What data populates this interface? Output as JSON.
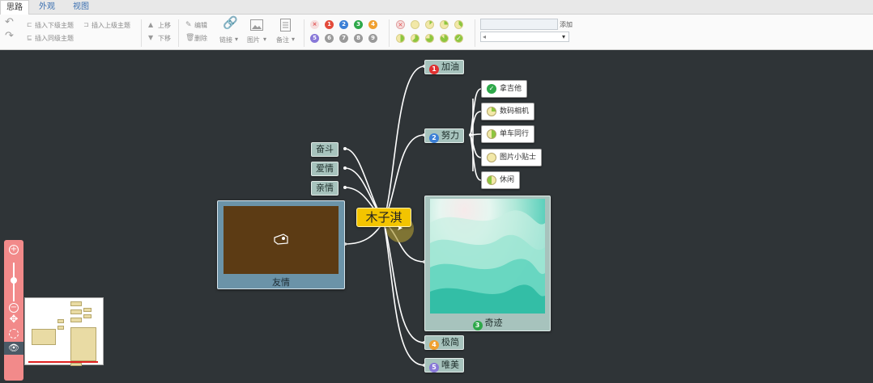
{
  "tabs": [
    {
      "label": "思路",
      "active": true
    },
    {
      "label": "外观",
      "active": false
    },
    {
      "label": "视图",
      "active": false
    }
  ],
  "toolbar": {
    "insert_child": "插入下级主题",
    "insert_parent": "插入上级主题",
    "insert_sibling": "插入同级主题",
    "move_up": "上移",
    "move_down": "下移",
    "edit": "编辑",
    "delete": "删除",
    "link": "链接",
    "image": "图片",
    "note": "备注",
    "priority_icons": [
      {
        "label": "×",
        "color": "#f0a0a0"
      },
      {
        "label": "1",
        "color": "#e34a3a"
      },
      {
        "label": "2",
        "color": "#3b7fd6"
      },
      {
        "label": "3",
        "color": "#2ea84a"
      },
      {
        "label": "4",
        "color": "#f0a030"
      },
      {
        "label": "5",
        "color": "#8878d8"
      },
      {
        "label": "6",
        "color": "#9a9a9a"
      },
      {
        "label": "7",
        "color": "#9a9a9a"
      },
      {
        "label": "8",
        "color": "#9a9a9a"
      },
      {
        "label": "9",
        "color": "#9a9a9a"
      }
    ],
    "progress_icons": [
      {
        "fraction": null
      },
      {
        "fraction": 0
      },
      {
        "fraction": 0.125
      },
      {
        "fraction": 0.25
      },
      {
        "fraction": 0.375
      },
      {
        "fraction": 0.5
      },
      {
        "fraction": 0.625
      },
      {
        "fraction": 0.75
      },
      {
        "fraction": 0.875
      },
      {
        "fraction": 1
      }
    ],
    "select_right": "添加",
    "select_left": "◂"
  },
  "mindmap": {
    "root": "木子淇",
    "branches": {
      "jiayou": {
        "label": "加油",
        "priority": "1",
        "priority_color": "#e03030"
      },
      "nuli": {
        "label": "努力",
        "priority": "2",
        "priority_color": "#3b7fd6"
      },
      "qiji": {
        "label": "奇迹",
        "priority": "3",
        "priority_color": "#2ea84a"
      },
      "jidu": {
        "label": "极简",
        "priority": "4",
        "priority_color": "#f0a030"
      },
      "wanmei": {
        "label": "唯美",
        "priority": "5",
        "priority_color": "#8878d8"
      },
      "fendou": {
        "label": "奋斗"
      },
      "aixin": {
        "label": "爱情"
      },
      "qinqing": {
        "label": "亲情"
      },
      "youqing": {
        "label": "友情"
      }
    },
    "subs": [
      {
        "label": "拿吉他",
        "icon": "check"
      },
      {
        "label": "数码相机",
        "icon": "quarter"
      },
      {
        "label": "单车同行",
        "icon": "half"
      },
      {
        "label": "图片小贴士",
        "icon": "empty"
      },
      {
        "label": "休闲",
        "icon": "half"
      }
    ]
  },
  "controls": {
    "zoom_in": "+",
    "zoom_out": "−",
    "move": "✥",
    "locate": "◎",
    "eye": "👁"
  }
}
